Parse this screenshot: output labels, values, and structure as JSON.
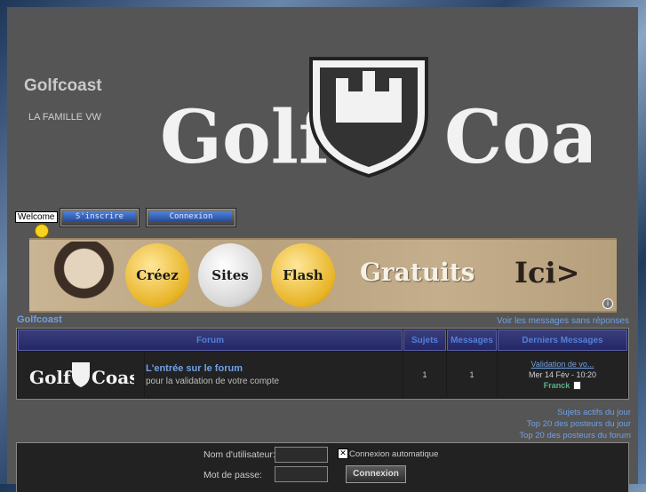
{
  "header": {
    "site_title": "Golfcoast",
    "site_subtitle": "LA FAMILLE VW",
    "logo_text_left": "Golf",
    "logo_text_right": "Coast"
  },
  "welcome": {
    "label": "Welcome"
  },
  "nav": {
    "register_label": "S'inscrire",
    "login_label": "Connexion"
  },
  "ad": {
    "word1": "Créez",
    "word2": "Sites",
    "word3": "Flash",
    "word4": "Gratuits",
    "word5": "Ici>",
    "info": "i"
  },
  "breadcrumb": {
    "label": "Golfcoast",
    "unanswered_link": "Voir les messages sans réponses"
  },
  "table": {
    "headers": {
      "forum": "Forum",
      "topics": "Sujets",
      "posts": "Messages",
      "last": "Derniers Messages"
    },
    "rows": [
      {
        "title": "L'entrée sur le forum",
        "desc": "pour la validation de votre compte",
        "topics": "1",
        "posts": "1",
        "last_title": "Validation de vo...",
        "last_date": "Mer 14 Fév - 10:20",
        "last_user": "Franck"
      }
    ]
  },
  "stats": {
    "active_today": "Sujets actifs du jour",
    "top20_today": "Top 20 des posteurs du jour",
    "top20_forum": "Top 20 des posteurs du forum"
  },
  "login": {
    "username_label": "Nom d'utilisateur:",
    "password_label": "Mot de passe:",
    "auto_label": "Connexion automatique",
    "submit_label": "Connexion"
  },
  "colors": {
    "link": "#6fa0e6",
    "page_bg": "#555555",
    "table_bg": "#222222"
  }
}
